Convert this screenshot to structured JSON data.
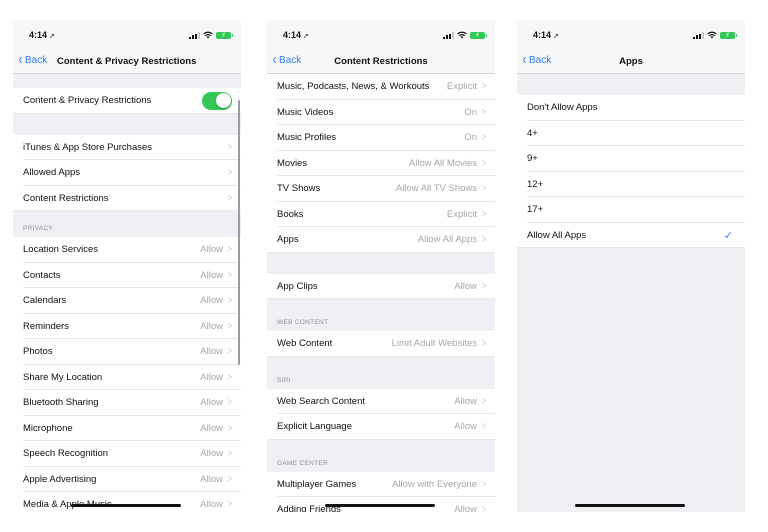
{
  "status": {
    "time": "4:14",
    "location_icon": "location-arrow-icon",
    "signal_icon": "signal-bars-icon",
    "wifi_icon": "wifi-icon",
    "battery_icon": "battery-charging-icon",
    "battery_color": "#34c759"
  },
  "accent_color": "#2f7cf6",
  "screen1": {
    "nav": {
      "back": "Back",
      "title": "Content & Privacy Restrictions"
    },
    "toggle_row": {
      "label": "Content & Privacy Restrictions",
      "on": true
    },
    "group1": [
      {
        "label": "iTunes & App Store Purchases"
      },
      {
        "label": "Allowed Apps"
      },
      {
        "label": "Content Restrictions"
      }
    ],
    "privacy_header": "PRIVACY",
    "privacy": [
      {
        "label": "Location Services",
        "value": "Allow"
      },
      {
        "label": "Contacts",
        "value": "Allow"
      },
      {
        "label": "Calendars",
        "value": "Allow"
      },
      {
        "label": "Reminders",
        "value": "Allow"
      },
      {
        "label": "Photos",
        "value": "Allow"
      },
      {
        "label": "Share My Location",
        "value": "Allow"
      },
      {
        "label": "Bluetooth Sharing",
        "value": "Allow"
      },
      {
        "label": "Microphone",
        "value": "Allow"
      },
      {
        "label": "Speech Recognition",
        "value": "Allow"
      },
      {
        "label": "Apple Advertising",
        "value": "Allow"
      },
      {
        "label": "Media & Apple Music",
        "value": "Allow"
      }
    ]
  },
  "screen2": {
    "nav": {
      "back": "Back",
      "title": "Content Restrictions"
    },
    "group1": [
      {
        "label": "Music, Podcasts, News, & Workouts",
        "value": "Explicit"
      },
      {
        "label": "Music Videos",
        "value": "On"
      },
      {
        "label": "Music Profiles",
        "value": "On"
      },
      {
        "label": "Movies",
        "value": "Allow All Movies"
      },
      {
        "label": "TV Shows",
        "value": "Allow All TV Shows"
      },
      {
        "label": "Books",
        "value": "Explicit"
      },
      {
        "label": "Apps",
        "value": "Allow All Apps"
      }
    ],
    "group2": [
      {
        "label": "App Clips",
        "value": "Allow"
      }
    ],
    "web_header": "WEB CONTENT",
    "web": [
      {
        "label": "Web Content",
        "value": "Limit Adult Websites"
      }
    ],
    "siri_header": "SIRI",
    "siri": [
      {
        "label": "Web Search Content",
        "value": "Allow"
      },
      {
        "label": "Explicit Language",
        "value": "Allow"
      }
    ],
    "game_header": "GAME CENTER",
    "game": [
      {
        "label": "Multiplayer Games",
        "value": "Allow with Everyone"
      },
      {
        "label": "Adding Friends",
        "value": "Allow"
      }
    ]
  },
  "screen3": {
    "nav": {
      "back": "Back",
      "title": "Apps"
    },
    "options": [
      {
        "label": "Don't Allow Apps",
        "selected": false
      },
      {
        "label": "4+",
        "selected": false
      },
      {
        "label": "9+",
        "selected": false
      },
      {
        "label": "12+",
        "selected": false
      },
      {
        "label": "17+",
        "selected": false
      },
      {
        "label": "Allow All Apps",
        "selected": true
      }
    ]
  }
}
